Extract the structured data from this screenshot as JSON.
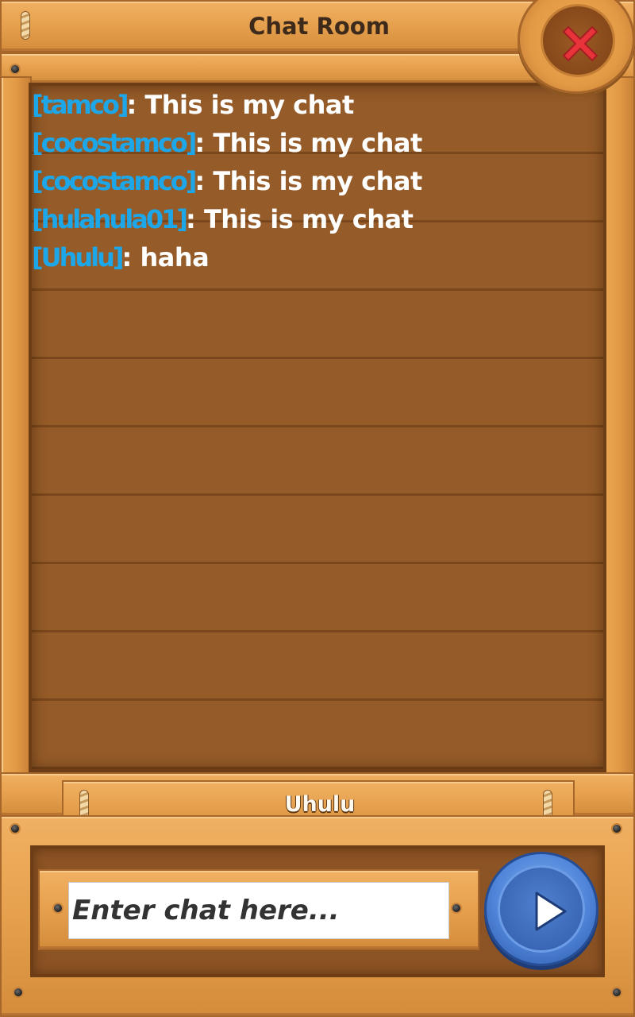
{
  "header": {
    "title": "Chat Room"
  },
  "chat": {
    "messages": [
      {
        "user": "[tamco]",
        "sep": ":",
        "text": " This is my chat"
      },
      {
        "user": "[cocostamco]",
        "sep": ":",
        "text": " This is my chat"
      },
      {
        "user": "[cocostamco]",
        "sep": ":",
        "text": " This is my chat"
      },
      {
        "user": "[hulahula01]",
        "sep": ":",
        "text": " This is my chat"
      },
      {
        "user": "[Uhulu]",
        "sep": ":",
        "text": " haha"
      }
    ]
  },
  "player": {
    "name": "Uhulu"
  },
  "composer": {
    "placeholder": "Enter chat here..."
  },
  "icons": {
    "close": "close-icon",
    "send": "play-icon"
  },
  "colors": {
    "username": "#1da7e8",
    "message": "#ffffff",
    "close": "#e8333a",
    "send": "#4f84d8"
  }
}
